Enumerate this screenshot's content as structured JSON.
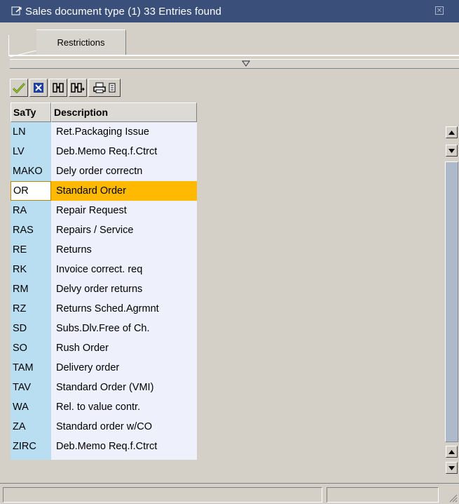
{
  "window": {
    "title": "Sales document type (1)   33 Entries found",
    "icon": "dialog-window-icon",
    "close_icon": "close-icon"
  },
  "tabs": [
    {
      "label": "Restrictions"
    }
  ],
  "toolbar": {
    "buttons": [
      {
        "name": "continue-check-icon"
      },
      {
        "name": "cancel-x-icon"
      },
      {
        "name": "find-binoculars-icon"
      },
      {
        "name": "find-next-binoculars-icon"
      },
      {
        "name": "print-icon"
      }
    ]
  },
  "grid": {
    "headers": {
      "saty": "SaTy",
      "description": "Description"
    },
    "rows": [
      {
        "saty": "LN",
        "description": "Ret.Packaging Issue"
      },
      {
        "saty": "LV",
        "description": "Deb.Memo Req.f.Ctrct"
      },
      {
        "saty": "MAKO",
        "description": "Dely order correctn"
      },
      {
        "saty": "OR",
        "description": "Standard Order",
        "selected": true
      },
      {
        "saty": "RA",
        "description": "Repair Request"
      },
      {
        "saty": "RAS",
        "description": "Repairs / Service"
      },
      {
        "saty": "RE",
        "description": "Returns"
      },
      {
        "saty": "RK",
        "description": "Invoice correct. req"
      },
      {
        "saty": "RM",
        "description": "Delvy order returns"
      },
      {
        "saty": "RZ",
        "description": "Returns Sched.Agrmnt"
      },
      {
        "saty": "SD",
        "description": "Subs.Dlv.Free of Ch."
      },
      {
        "saty": "SO",
        "description": "Rush Order"
      },
      {
        "saty": "TAM",
        "description": "Delivery order"
      },
      {
        "saty": "TAV",
        "description": "Standard Order (VMI)"
      },
      {
        "saty": "WA",
        "description": "Rel. to value contr."
      },
      {
        "saty": "ZA",
        "description": "Standard order w/CO"
      },
      {
        "saty": "ZIRC",
        "description": "Deb.Memo Req.f.Ctrct"
      }
    ]
  },
  "colors": {
    "titlebar": "#3a4f7a",
    "key_column": "#b9def2",
    "desc_column": "#eef1fb",
    "selected_row": "#ffba00",
    "confirm_green": "#2e8b2e",
    "cancel_blue": "#1f3f9e"
  }
}
